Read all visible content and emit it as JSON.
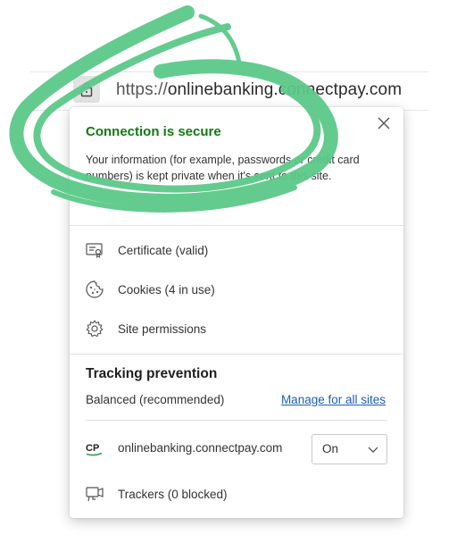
{
  "addressbar": {
    "url_scheme": "https://",
    "url_host": "onlinebanking.connectpay.com"
  },
  "popup": {
    "title": "Connection is secure",
    "description": "Your information (for example, passwords or credit card numbers) is kept private when it's sent to this site.",
    "menu": [
      {
        "label": "Certificate (valid)",
        "icon": "certificate-icon"
      },
      {
        "label": "Cookies (4 in use)",
        "icon": "cookie-icon"
      },
      {
        "label": "Site permissions",
        "icon": "gear-icon"
      }
    ],
    "tracking": {
      "title": "Tracking prevention",
      "mode": "Balanced (recommended)",
      "manage_link": "Manage for all sites",
      "site_logo": "CP",
      "site": "onlinebanking.connectpay.com",
      "toggle_value": "On",
      "trackers": "Trackers (0 blocked)"
    }
  },
  "colors": {
    "secure_green": "#107c10",
    "link_blue": "#1a5fb4",
    "highlight_brush": "#5cc98a"
  }
}
